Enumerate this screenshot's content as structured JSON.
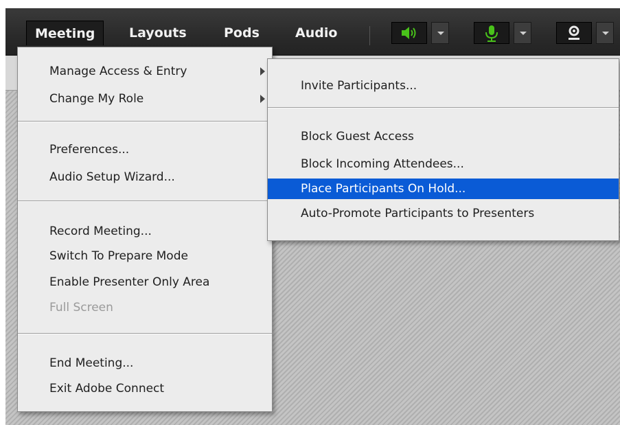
{
  "menubar": {
    "items": [
      {
        "label": "Meeting",
        "active": true
      },
      {
        "label": "Layouts",
        "active": false
      },
      {
        "label": "Pods",
        "active": false
      },
      {
        "label": "Audio",
        "active": false
      }
    ],
    "controls": {
      "speaker_icon": "speaker-icon",
      "mic_icon": "microphone-icon",
      "camera_icon": "webcam-icon",
      "accent_green": "#49c21a"
    }
  },
  "meeting_menu": {
    "groups": [
      [
        {
          "label": "Manage Access & Entry",
          "submenu": true
        },
        {
          "label": "Change My Role",
          "submenu": true
        }
      ],
      [
        {
          "label": "Preferences..."
        },
        {
          "label": "Audio Setup Wizard..."
        }
      ],
      [
        {
          "label": "Record Meeting..."
        },
        {
          "label": "Switch To Prepare Mode"
        },
        {
          "label": "Enable Presenter Only Area"
        },
        {
          "label": "Full Screen",
          "disabled": true
        }
      ],
      [
        {
          "label": "End Meeting..."
        },
        {
          "label": "Exit Adobe Connect"
        }
      ]
    ]
  },
  "access_submenu": {
    "groups": [
      [
        {
          "label": "Invite Participants..."
        }
      ],
      [
        {
          "label": "Block Guest Access"
        },
        {
          "label": "Block Incoming Attendees..."
        },
        {
          "label": "Place Participants On Hold...",
          "highlighted": true
        },
        {
          "label": "Auto-Promote Participants to Presenters"
        }
      ]
    ],
    "highlight_color": "#0a5bd6"
  }
}
